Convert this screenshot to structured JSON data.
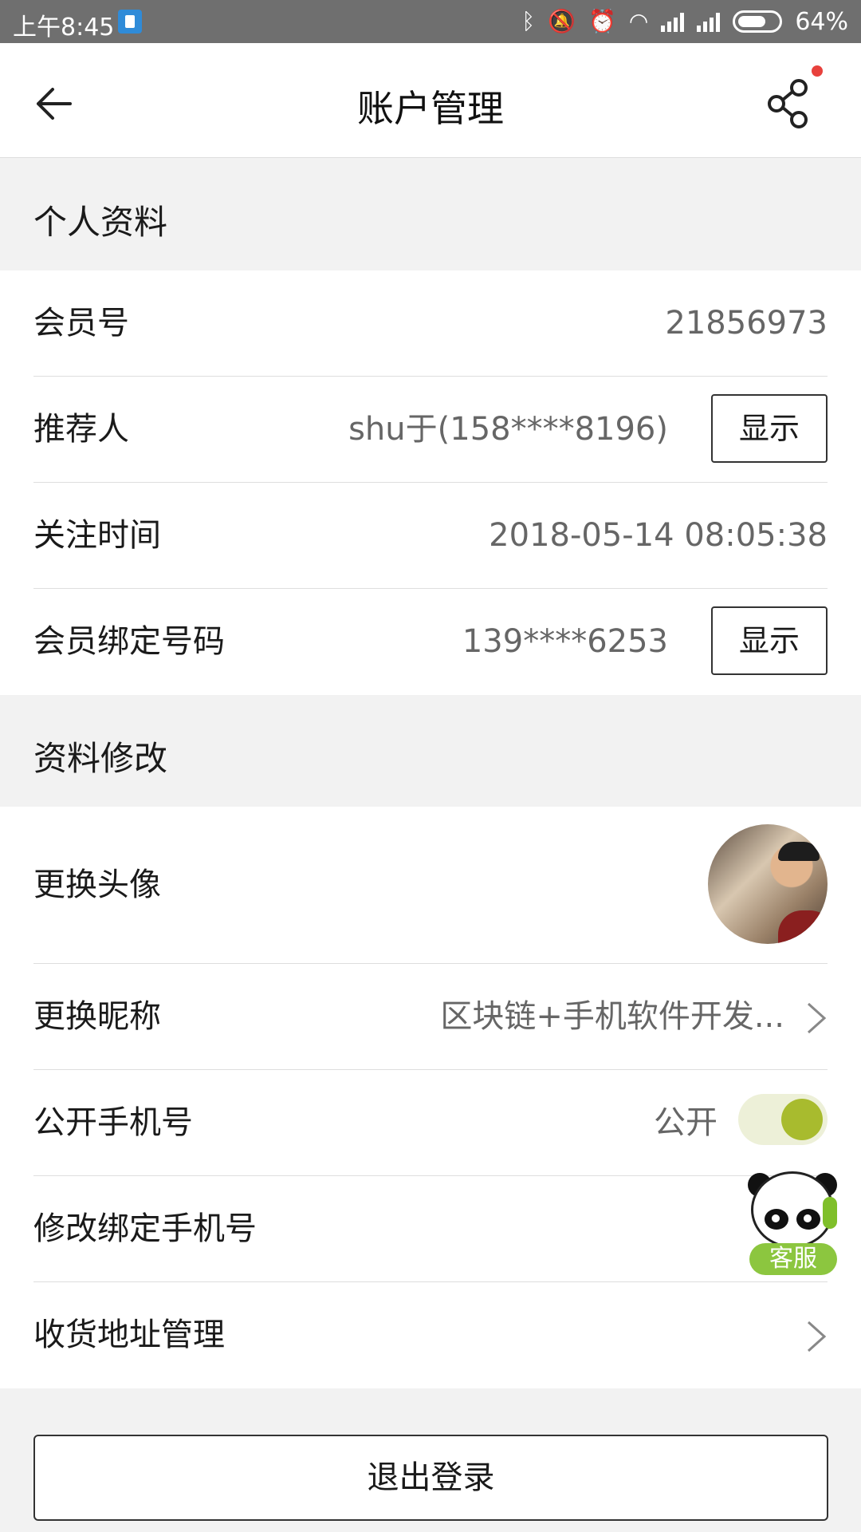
{
  "status_bar": {
    "time": "上午8:45",
    "battery": "64%",
    "icons": [
      "app-notification-icon",
      "bluetooth-icon",
      "mute-vibrate-icon",
      "alarm-icon",
      "wifi-icon",
      "signal-icon",
      "signal-icon",
      "battery-icon"
    ]
  },
  "nav": {
    "title": "账户管理",
    "back_icon": "arrow-left-icon",
    "share_icon": "share-icon"
  },
  "personal_section": {
    "header": "个人资料",
    "rows": [
      {
        "label": "会员号",
        "value": "21856973"
      },
      {
        "label": "推荐人",
        "value": "shu于(158****8196)",
        "button": "显示"
      },
      {
        "label": "关注时间",
        "value": "2018-05-14 08:05:38"
      },
      {
        "label": "会员绑定号码",
        "value": "139****6253",
        "button": "显示"
      }
    ]
  },
  "edit_section": {
    "header": "资料修改",
    "rows": [
      {
        "label": "更换头像"
      },
      {
        "label": "更换昵称",
        "value": "区块链+手机软件开发..."
      },
      {
        "label": "公开手机号",
        "value": "公开",
        "toggle_on": true
      },
      {
        "label": "修改绑定手机号"
      },
      {
        "label": "收货地址管理"
      }
    ]
  },
  "customer_service": {
    "label": "客服"
  },
  "logout_label": "退出登录",
  "colors": {
    "toggle_on": "#a8bb2e",
    "service_green": "#8cc63f",
    "notify_dot": "#e8413c"
  }
}
